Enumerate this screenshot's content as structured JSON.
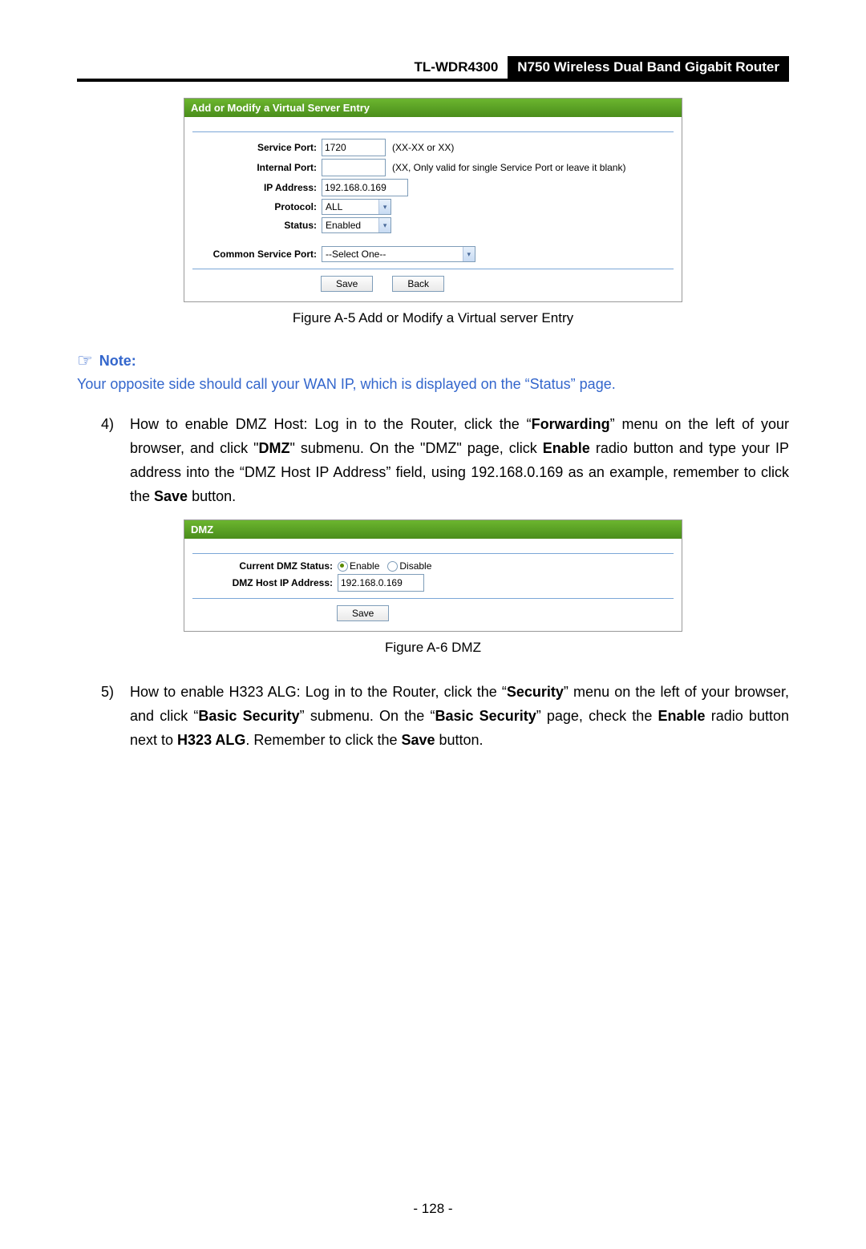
{
  "header": {
    "model": "TL-WDR4300",
    "product": "N750 Wireless Dual Band Gigabit Router"
  },
  "vs": {
    "title": "Add or Modify a Virtual Server Entry",
    "labels": {
      "service_port": "Service Port:",
      "internal_port": "Internal Port:",
      "ip_address": "IP Address:",
      "protocol": "Protocol:",
      "status": "Status:",
      "common_service_port": "Common Service Port:"
    },
    "values": {
      "service_port": "1720",
      "internal_port": "",
      "ip_address": "192.168.0.169",
      "protocol": "ALL",
      "status": "Enabled",
      "common_service_port": "--Select One--"
    },
    "hints": {
      "service_port": "(XX-XX or XX)",
      "internal_port": "(XX, Only valid for single Service Port or leave it blank)"
    },
    "buttons": {
      "save": "Save",
      "back": "Back"
    }
  },
  "fig_a5": "Figure A-5 Add or Modify a Virtual server Entry",
  "note": {
    "label": "Note:",
    "text": "Your opposite side should call your WAN IP, which is displayed on the “Status” page."
  },
  "item4": {
    "num": "4)",
    "t1": "How to enable DMZ Host: Log in to the Router, click the “",
    "bold1": "Forwarding",
    "t2": "” menu on the left of your browser, and click \"",
    "bold2": "DMZ",
    "t3": "\" submenu. On the \"DMZ\" page, click ",
    "bold3": "Enable",
    "t4": " radio button and type your IP address into the “DMZ Host IP Address” field, using 192.168.0.169 as an example, remember to click the ",
    "bold4": "Save",
    "t5": " button."
  },
  "dmz": {
    "title": "DMZ",
    "labels": {
      "status": "Current DMZ Status:",
      "host_ip": "DMZ Host IP Address:"
    },
    "radio": {
      "enable": "Enable",
      "disable": "Disable"
    },
    "values": {
      "host_ip": "192.168.0.169"
    },
    "buttons": {
      "save": "Save"
    }
  },
  "fig_a6": "Figure A-6 DMZ",
  "item5": {
    "num": "5)",
    "t1": "How to enable H323 ALG: Log in to the Router, click the “",
    "bold1": "Security",
    "t2": "” menu on the left of your browser, and click “",
    "bold2": "Basic Security",
    "t3": "” submenu. On the “",
    "bold3": "Basic Security",
    "t4": "” page, check the ",
    "bold4": "Enable",
    "t5": " radio button next to ",
    "bold5": "H323 ALG",
    "t6": ". Remember to click the ",
    "bold6": "Save",
    "t7": " button."
  },
  "page_number": "- 128 -"
}
